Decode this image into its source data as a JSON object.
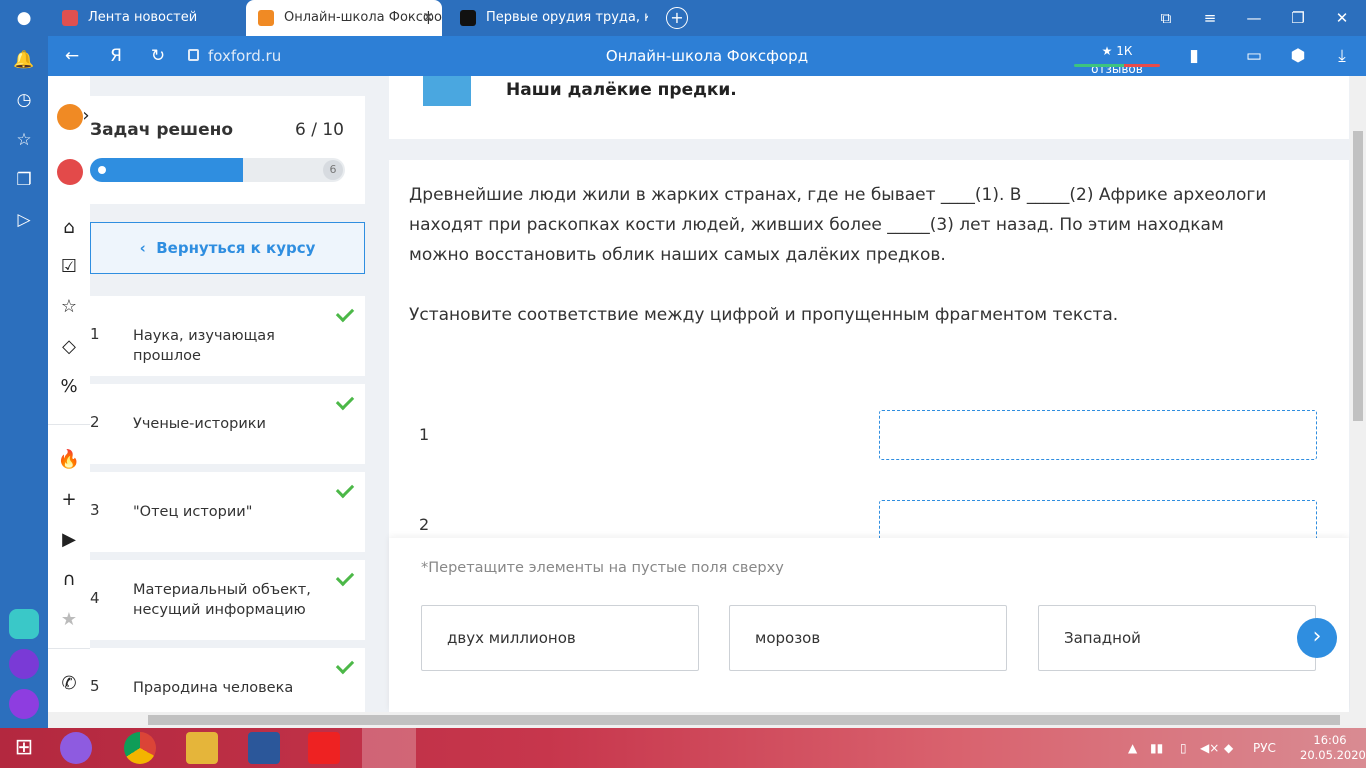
{
  "browser": {
    "tabs": [
      {
        "label": "Лента новостей"
      },
      {
        "label": "Онлайн-школа Фоксфорд"
      },
      {
        "label": "Первые орудия труда, ко"
      }
    ],
    "url": "foxford.ru",
    "page_title": "Онлайн-школа Фоксфорд",
    "reviews": "★ 1К отзывов"
  },
  "header": {
    "lesson_title": "Наши далёкие предки."
  },
  "progress": {
    "label": "Задач решено",
    "count": "6 / 10",
    "total_marker": "6",
    "fraction": 0.6
  },
  "back_button": "Вернуться к курсу",
  "tasks": [
    {
      "num": "1",
      "title": "Наука, изучающая прошлое"
    },
    {
      "num": "2",
      "title": "Ученые-историки"
    },
    {
      "num": "3",
      "title": "\"Отец истории\""
    },
    {
      "num": "4",
      "title": "Материальный объект, несущий информацию"
    },
    {
      "num": "5",
      "title": "Прародина человека"
    }
  ],
  "question": {
    "text": "Древнейшие люди жили в жарких странах, где не бывает ____(1). В _____(2) Африке археологи находят при раскопках кости людей, живших более _____(3) лет назад. По этим находкам можно восстановить облик наших самых далёких предков.",
    "instruction": "Установите соответствие между цифрой и пропущенным фрагментом текста.",
    "rows": [
      "1",
      "2"
    ],
    "hint": "*Перетащите элементы на пустые поля сверху",
    "options": [
      "двух миллионов",
      "морозов",
      "Западной"
    ]
  },
  "taskbar": {
    "lang": "РУС",
    "time": "16:06",
    "date": "20.05.2020"
  },
  "colors": {
    "accent": "#2f8ee0",
    "success": "#4cb848",
    "browser_bar": "#2c6fbd"
  }
}
